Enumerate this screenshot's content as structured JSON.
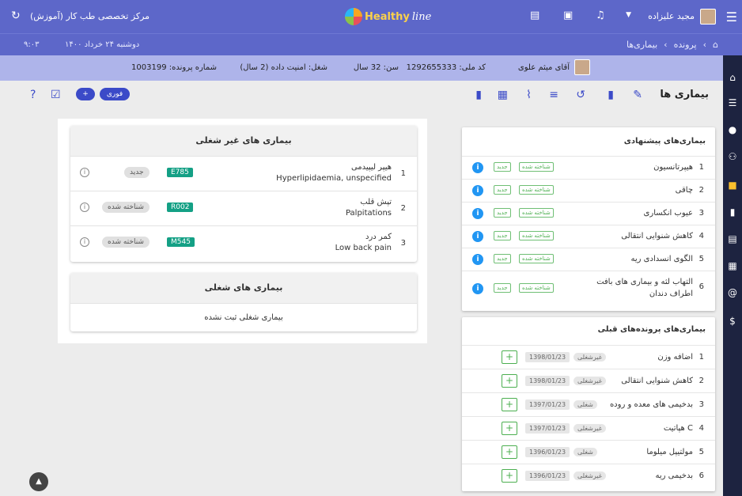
{
  "topbar": {
    "center_name": "مرکز تخصصی طب کار (آموزش)",
    "user_name": "مجید علیزاده",
    "logo_text1": "Healthy",
    "logo_text2": "line"
  },
  "subbar": {
    "breadcrumb": [
      "پرونده",
      "بیماری‌ها"
    ],
    "date": "دوشنبه ۲۴ خرداد ۱۴۰۰",
    "time": "۹:۰۳"
  },
  "patient": {
    "name": "آقای میثم علوی",
    "national_id": "کد ملی: 1292655333",
    "age": "سن: 32 سال",
    "job": "شغل: امنیت داده (2 سال)",
    "file_no": "شماره پرونده: 1003199"
  },
  "toolbar": {
    "title": "بیماری ها",
    "urgent_label": "فوری",
    "add_label": "+"
  },
  "non_occupational": {
    "title": "بیماری های غیر شغلی",
    "rows": [
      {
        "num": "1",
        "fa": "هیپر لیپیدمی",
        "en": "Hyperlipidaemia, unspecified",
        "code": "E785",
        "status": "جدید"
      },
      {
        "num": "2",
        "fa": "تپش قلب",
        "en": "Palpitations",
        "code": "R002",
        "status": "شناخته شده"
      },
      {
        "num": "3",
        "fa": "کمر درد",
        "en": "Low back pain",
        "code": "M545",
        "status": "شناخته شده"
      }
    ]
  },
  "occupational": {
    "title": "بیماری های شغلی",
    "empty": "بیماری شغلی ثبت نشده"
  },
  "suggested": {
    "title": "بیماری‌های پیشنهادی",
    "known_label": "شناخته شده",
    "new_label": "جدید",
    "rows": [
      {
        "num": "1",
        "label": "هیپرتانسیون"
      },
      {
        "num": "2",
        "label": "چاقی"
      },
      {
        "num": "3",
        "label": "عیوب انکساری"
      },
      {
        "num": "4",
        "label": "کاهش شنوایی انتقالی"
      },
      {
        "num": "5",
        "label": "الگوی انسدادی ریه"
      },
      {
        "num": "6",
        "label": "التهاب لثه و بیماری های بافت اطراف دندان"
      }
    ]
  },
  "previous": {
    "title": "بیماری‌های پرونده‌های قبلی",
    "rows": [
      {
        "num": "1",
        "label": "اضافه وزن",
        "kind": "غیرشغلی",
        "date": "1398/01/23"
      },
      {
        "num": "2",
        "label": "کاهش شنوایی انتقالی",
        "kind": "غیرشغلی",
        "date": "1398/01/23"
      },
      {
        "num": "3",
        "label": "بدخیمی های معده و روده",
        "kind": "شغلی",
        "date": "1397/01/23"
      },
      {
        "num": "4",
        "label": "هپاتیت C",
        "kind": "غیرشغلی",
        "date": "1397/01/23"
      },
      {
        "num": "5",
        "label": "مولتیپل میلوما",
        "kind": "شغلی",
        "date": "1396/01/23"
      },
      {
        "num": "6",
        "label": "بدخیمی ریه",
        "kind": "غیرشغلی",
        "date": "1396/01/23"
      }
    ]
  }
}
